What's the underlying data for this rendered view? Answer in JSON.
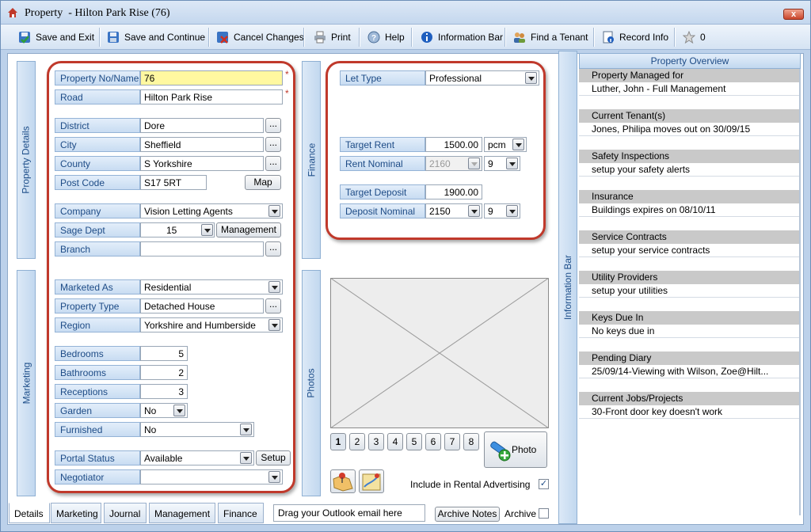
{
  "window": {
    "app_name": "Property",
    "title_rest": "- Hilton Park Rise (76)",
    "close": "x"
  },
  "toolbar": {
    "save_exit": "Save and Exit",
    "save_continue": "Save and Continue",
    "cancel": "Cancel Changes",
    "print": "Print",
    "help": "Help",
    "info_bar": "Information Bar",
    "find_tenant": "Find a Tenant",
    "record_info": "Record Info",
    "star_count": "0"
  },
  "side_tabs": {
    "property_details": "Property Details",
    "marketing": "Marketing",
    "finance": "Finance",
    "photos": "Photos",
    "information_bar": "Information Bar"
  },
  "property": {
    "property_no_label": "Property No/Name",
    "property_no": "76",
    "road_label": "Road",
    "road": "Hilton Park Rise",
    "district_label": "District",
    "district": "Dore",
    "city_label": "City",
    "city": "Sheffield",
    "county_label": "County",
    "county": "S Yorkshire",
    "postcode_label": "Post Code",
    "postcode": "S17 5RT",
    "map_button": "Map",
    "company_label": "Company",
    "company": "Vision Letting Agents",
    "sage_label": "Sage Dept",
    "sage": "15",
    "management_button": "Management",
    "branch_label": "Branch",
    "branch": "",
    "ellipsis": "...",
    "required": "*"
  },
  "marketing": {
    "marketed_as_label": "Marketed As",
    "marketed_as": "Residential",
    "type_label": "Property Type",
    "type": "Detached House",
    "region_label": "Region",
    "region": "Yorkshire and Humberside",
    "bedrooms_label": "Bedrooms",
    "bedrooms": "5",
    "bathrooms_label": "Bathrooms",
    "bathrooms": "2",
    "receptions_label": "Receptions",
    "receptions": "3",
    "garden_label": "Garden",
    "garden": "No",
    "furnished_label": "Furnished",
    "furnished": "No",
    "portal_label": "Portal Status",
    "portal": "Available",
    "setup_button": "Setup",
    "negotiator_label": "Negotiator",
    "negotiator": ""
  },
  "finance": {
    "let_type_label": "Let Type",
    "let_type": "Professional",
    "target_rent_label": "Target Rent",
    "target_rent": "1500.00",
    "period": "pcm",
    "rent_nominal_label": "Rent Nominal",
    "rent_nominal": "2160",
    "rent_nominal_sub": "9",
    "target_deposit_label": "Target Deposit",
    "target_deposit": "1900.00",
    "deposit_nominal_label": "Deposit Nominal",
    "deposit_nominal": "2150",
    "deposit_nominal_sub": "9"
  },
  "photos": {
    "pages": [
      "1",
      "2",
      "3",
      "4",
      "5",
      "6",
      "7",
      "8"
    ],
    "photo_button": "Photo",
    "rental_advertising_label": "Include in  Rental Advertising",
    "rental_advertising_checked": true,
    "checked_mark": "✓"
  },
  "overview": {
    "title": "Property Overview",
    "sections": [
      {
        "heading": "Property Managed for",
        "value": "Luther, John - Full Management"
      },
      {
        "heading": "Current Tenant(s)",
        "value": "Jones, Philipa moves out on 30/09/15"
      },
      {
        "heading": "Safety Inspections",
        "value": "setup your safety alerts"
      },
      {
        "heading": "Insurance",
        "value": "Buildings expires on 08/10/11"
      },
      {
        "heading": "Service Contracts",
        "value": "setup your service contracts"
      },
      {
        "heading": "Utility Providers",
        "value": "setup your utilities"
      },
      {
        "heading": "Keys Due In",
        "value": "No keys due in"
      },
      {
        "heading": "Pending Diary",
        "value": "25/09/14-Viewing with Wilson, Zoe@Hilt..."
      },
      {
        "heading": "Current Jobs/Projects",
        "value": "30-Front door key doesn't work"
      }
    ]
  },
  "bottom": {
    "tabs": [
      "Details",
      "Marketing",
      "Journal",
      "Management",
      "Finance"
    ],
    "outlook": "Drag your Outlook email here",
    "archive_notes": "Archive Notes",
    "archive": "Archive"
  },
  "colors": {
    "frame": "#c0392b",
    "label_text": "#1d4b86",
    "highlight": "#fff8a0"
  }
}
